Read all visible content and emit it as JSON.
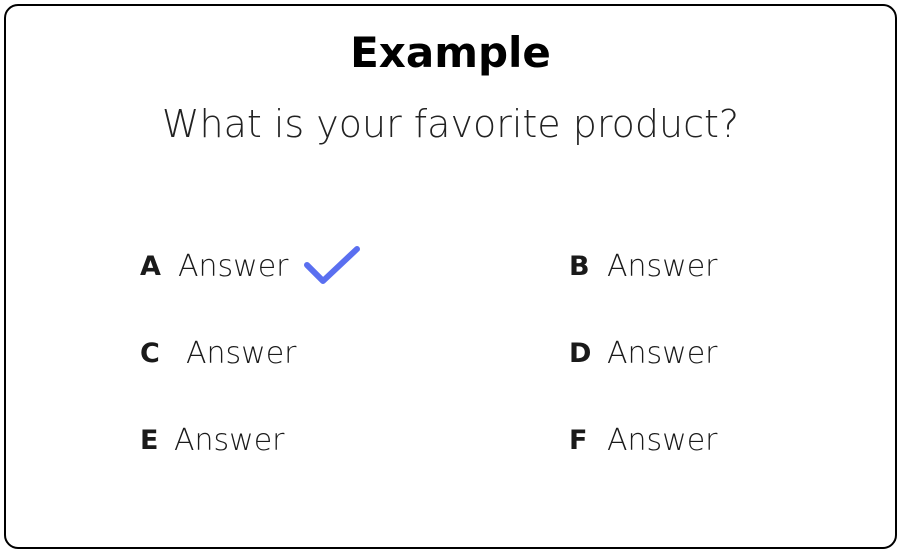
{
  "title": "Example",
  "question": "What is your favorite product?",
  "options": [
    {
      "letter": "A",
      "text": "Answer",
      "selected": true
    },
    {
      "letter": "B",
      "text": "Answer",
      "selected": false
    },
    {
      "letter": "C",
      "text": "Answer",
      "selected": false
    },
    {
      "letter": "D",
      "text": "Answer",
      "selected": false
    },
    {
      "letter": "E",
      "text": "Answer",
      "selected": false
    },
    {
      "letter": "F",
      "text": "Answer",
      "selected": false
    }
  ],
  "colors": {
    "check": "#5a6ff0",
    "border": "#000000"
  },
  "icons": {
    "selected": "checkmark-icon"
  }
}
